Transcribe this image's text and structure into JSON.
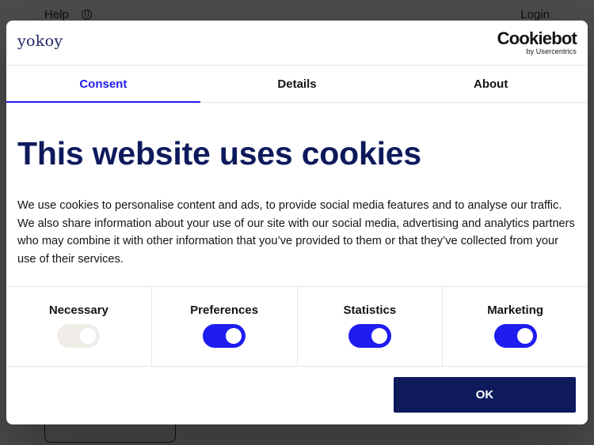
{
  "background": {
    "help_label": "Help",
    "login_label": "Login"
  },
  "header": {
    "brand_logo_text": "yokoy",
    "cookiebot_logo_text": "Cookiebot",
    "cookiebot_sub_text": "by Usercentrics"
  },
  "tabs": [
    {
      "label": "Consent",
      "active": true
    },
    {
      "label": "Details",
      "active": false
    },
    {
      "label": "About",
      "active": false
    }
  ],
  "main": {
    "title": "This website uses cookies",
    "description": "We use cookies to personalise content and ads, to provide social media features and to analyse our traffic. We also share information about your use of our site with our social media, advertising and analytics partners who may combine it with other information that you’ve provided to them or that they’ve collected from your use of their services."
  },
  "toggles": [
    {
      "label": "Necessary",
      "checked": true,
      "disabled": true
    },
    {
      "label": "Preferences",
      "checked": true,
      "disabled": false
    },
    {
      "label": "Statistics",
      "checked": true,
      "disabled": false
    },
    {
      "label": "Marketing",
      "checked": true,
      "disabled": false
    }
  ],
  "actions": {
    "ok_label": "OK"
  },
  "colors": {
    "accent": "#1f1cf0",
    "navy": "#0e1a5c",
    "disabled_switch": "#efece8"
  }
}
